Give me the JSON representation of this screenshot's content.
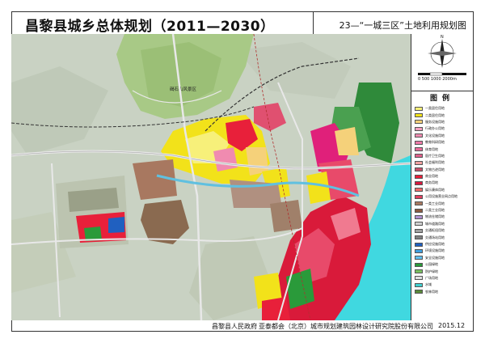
{
  "header": {
    "main_title": "昌黎县城乡总体规划（2011—2030）",
    "sub_title": "23—“一城三区”土地利用规划图"
  },
  "map": {
    "place_label": "碣石山风景区"
  },
  "legend": {
    "title": "图例",
    "scale_text": "0  500 1000     2000m",
    "items": [
      {
        "label": "一类居住用地",
        "color": "#f7f07a"
      },
      {
        "label": "二类居住用地",
        "color": "#f2e21a"
      },
      {
        "label": "服务设施用地",
        "color": "#f5d17a"
      },
      {
        "label": "行政办公用地",
        "color": "#f4a0c0"
      },
      {
        "label": "文化设施用地",
        "color": "#f08bb0"
      },
      {
        "label": "教育科研用地",
        "color": "#ee7aa8"
      },
      {
        "label": "体育用地",
        "color": "#e86a98"
      },
      {
        "label": "医疗卫生用地",
        "color": "#e0608a"
      },
      {
        "label": "社会福利用地",
        "color": "#f0a0a0"
      },
      {
        "label": "文物古迹用地",
        "color": "#c8506a"
      },
      {
        "label": "商业用地",
        "color": "#e8203a"
      },
      {
        "label": "商务用地",
        "color": "#d81a40"
      },
      {
        "label": "娱乐康体用地",
        "color": "#f06a6a"
      },
      {
        "label": "公用设施营业网点用地",
        "color": "#e04060"
      },
      {
        "label": "一类工业用地",
        "color": "#a87860"
      },
      {
        "label": "二类工业用地",
        "color": "#8a5a40"
      },
      {
        "label": "物流仓储用地",
        "color": "#b090d0"
      },
      {
        "label": "城市道路用地",
        "color": "#d0d0d0"
      },
      {
        "label": "交通枢纽用地",
        "color": "#a0a0a0"
      },
      {
        "label": "交通场站用地",
        "color": "#808080"
      },
      {
        "label": "供应设施用地",
        "color": "#2060c0"
      },
      {
        "label": "环境设施用地",
        "color": "#40a0e0"
      },
      {
        "label": "安全设施用地",
        "color": "#60c0f0"
      },
      {
        "label": "公园绿地",
        "color": "#2a9a3a"
      },
      {
        "label": "防护绿地",
        "color": "#7ac060"
      },
      {
        "label": "广场用地",
        "color": "#e0e0e0"
      },
      {
        "label": "水域",
        "color": "#40d0d0"
      },
      {
        "label": "农林用地",
        "color": "#5a8a3a"
      }
    ]
  },
  "footer": {
    "left": "昌黎县人民政府",
    "middle": "亚泰都会（北京）城市规划建筑园林设计研究院股份有限公司",
    "right": "2015.12"
  }
}
